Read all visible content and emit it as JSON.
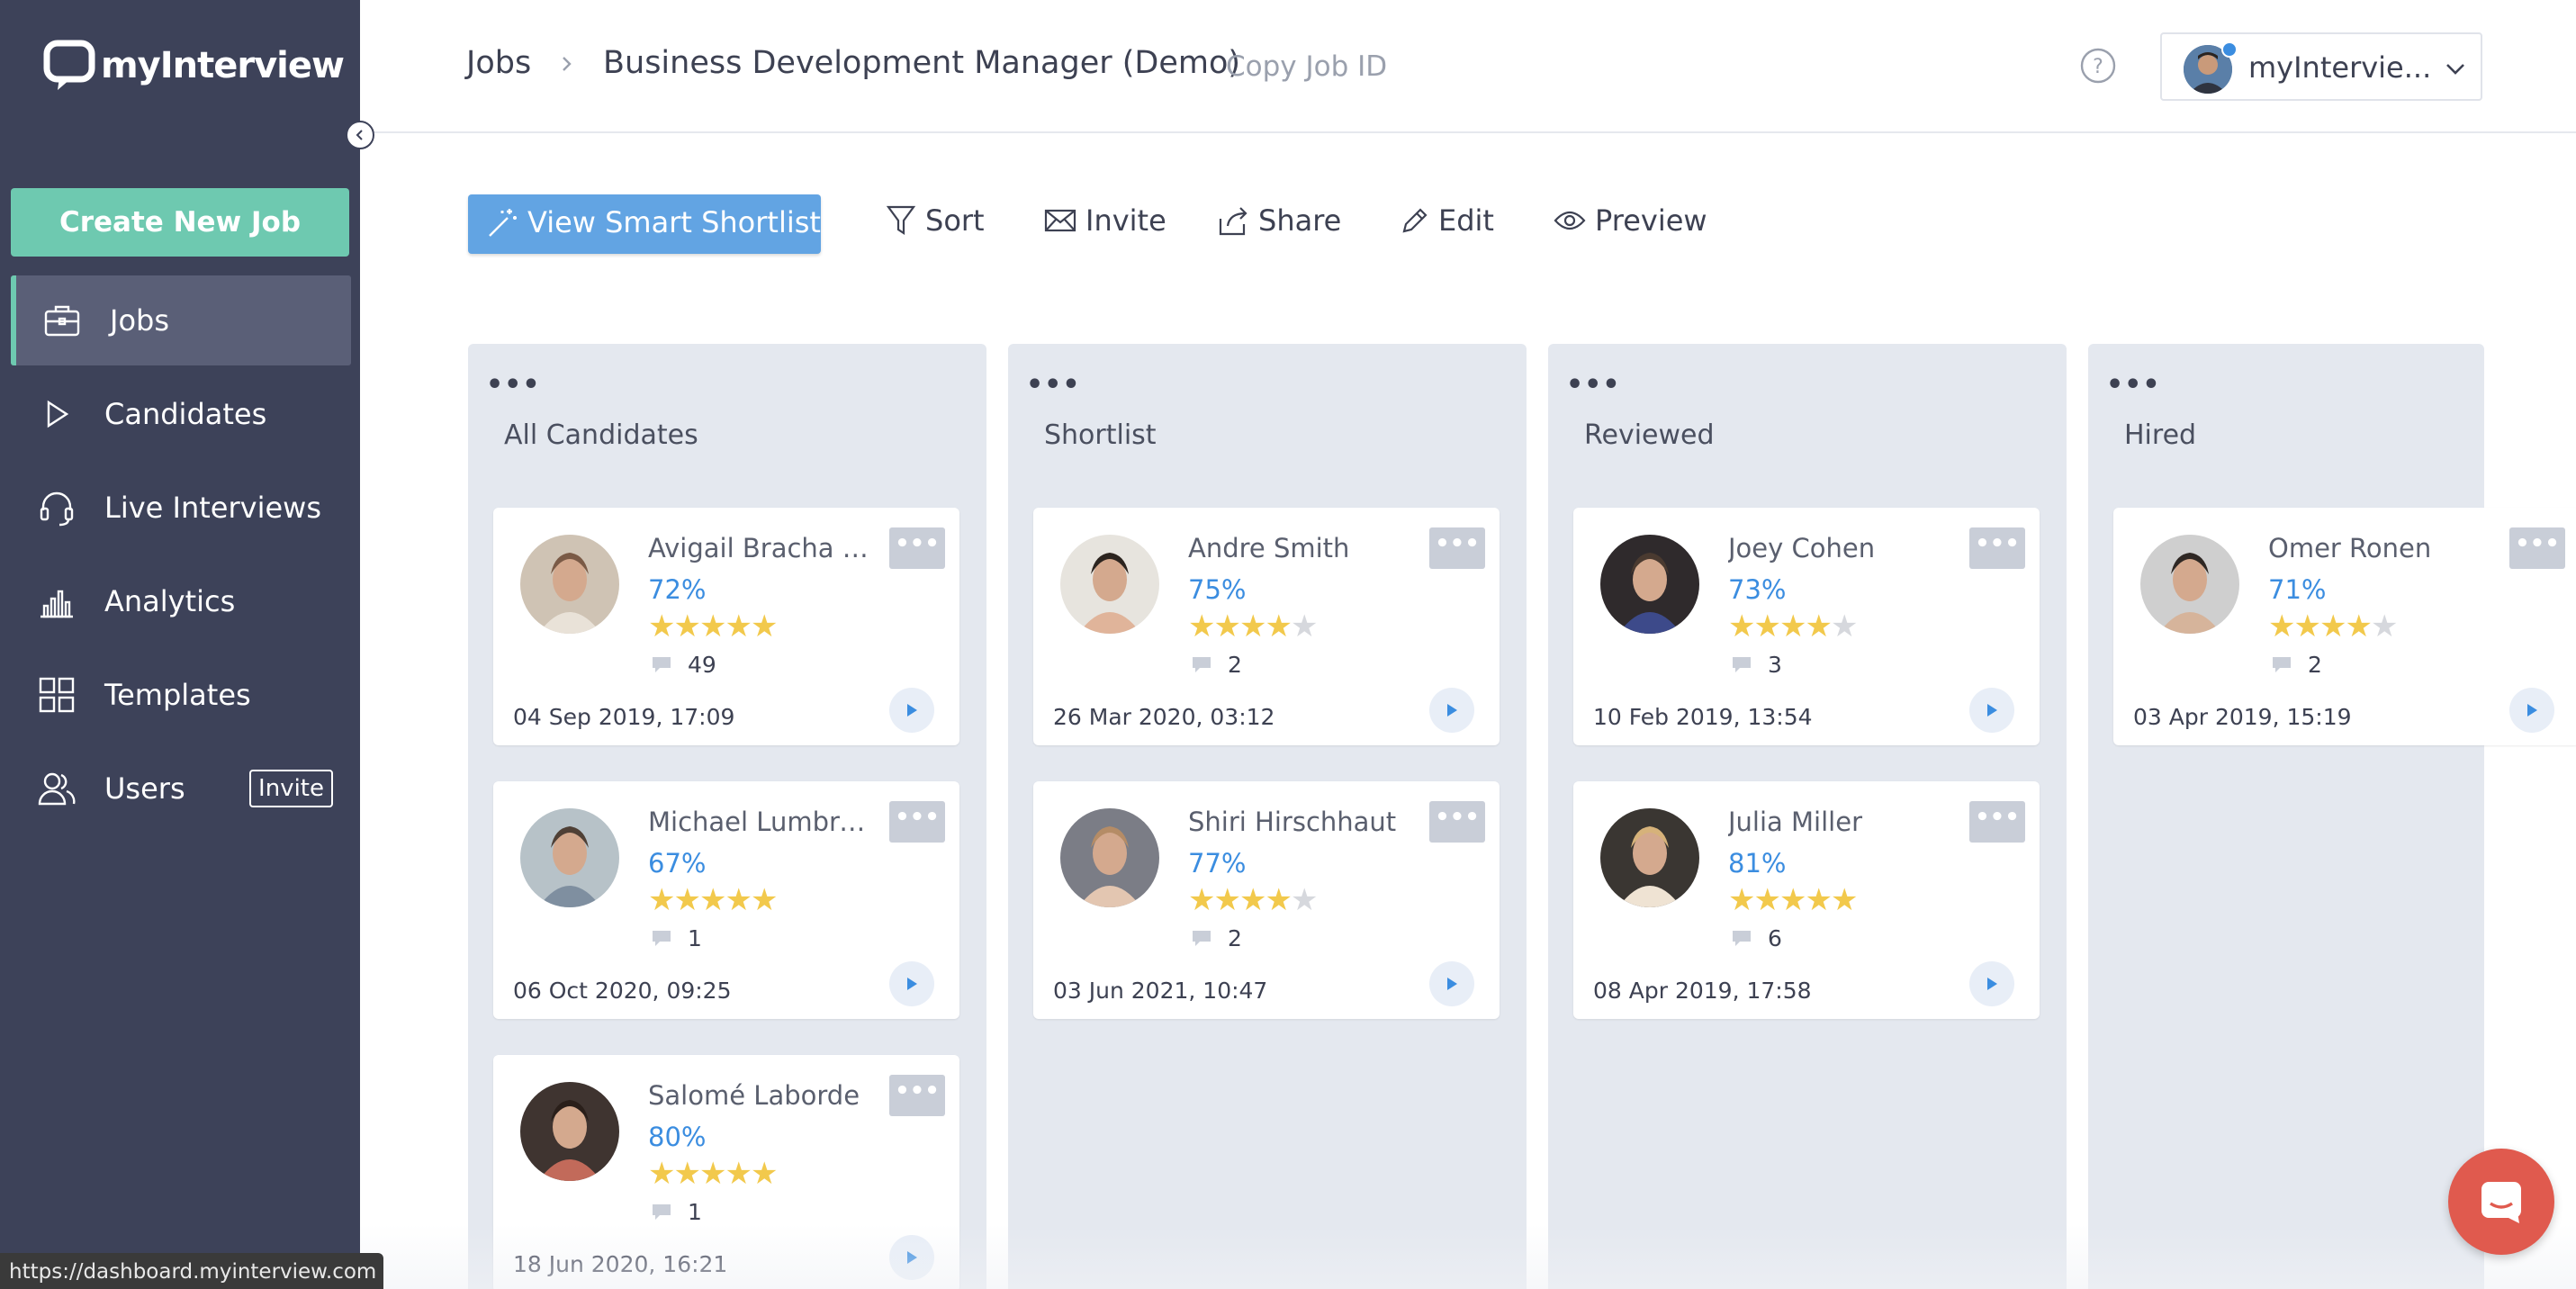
{
  "app": {
    "logo_text": "myInterview",
    "status_url": "https://dashboard.myinterview.com"
  },
  "sidebar": {
    "create_label": "Create New Job",
    "items": [
      {
        "label": "Jobs",
        "icon": "briefcase-icon"
      },
      {
        "label": "Candidates",
        "icon": "play-outline-icon"
      },
      {
        "label": "Live Interviews",
        "icon": "headset-icon"
      },
      {
        "label": "Analytics",
        "icon": "bar-chart-icon"
      },
      {
        "label": "Templates",
        "icon": "grid-icon"
      },
      {
        "label": "Users",
        "icon": "users-icon",
        "badge": "Invite"
      }
    ]
  },
  "header": {
    "breadcrumb_root": "Jobs",
    "job_title": "Business Development Manager (Demo)",
    "copy_job_id": "Copy Job ID",
    "account_name": "myIntervie..."
  },
  "toolbar": {
    "smart_shortlist": "View Smart Shortlist",
    "sort": "Sort",
    "invite": "Invite",
    "share": "Share",
    "edit": "Edit",
    "preview": "Preview"
  },
  "columns": [
    {
      "title": "All Candidates",
      "cards": [
        {
          "name": "Avigail Bracha So...",
          "score": "72%",
          "stars": 5,
          "comments": "49",
          "date": "04 Sep 2019, 17:09"
        },
        {
          "name": "Michael Lumbroso",
          "score": "67%",
          "stars": 5,
          "comments": "1",
          "date": "06 Oct 2020, 09:25"
        },
        {
          "name": "Salomé Laborde",
          "score": "80%",
          "stars": 5,
          "comments": "1",
          "date": "18 Jun 2020, 16:21"
        }
      ]
    },
    {
      "title": "Shortlist",
      "cards": [
        {
          "name": "Andre Smith",
          "score": "75%",
          "stars": 4,
          "comments": "2",
          "date": "26 Mar 2020, 03:12"
        },
        {
          "name": "Shiri Hirschhaut",
          "score": "77%",
          "stars": 4,
          "comments": "2",
          "date": "03 Jun 2021, 10:47"
        }
      ]
    },
    {
      "title": "Reviewed",
      "cards": [
        {
          "name": "Joey Cohen",
          "score": "73%",
          "stars": 4,
          "comments": "3",
          "date": "10 Feb 2019, 13:54"
        },
        {
          "name": "Julia Miller",
          "score": "81%",
          "stars": 5,
          "comments": "6",
          "date": "08 Apr 2019, 17:58"
        }
      ]
    },
    {
      "title": "Hired",
      "cards": [
        {
          "name": "Omer Ronen",
          "score": "71%",
          "stars": 4,
          "comments": "2",
          "date": "03 Apr 2019, 15:19"
        }
      ]
    }
  ],
  "colors": {
    "sidebar_bg": "#3d4259",
    "accent_green": "#6ec9b0",
    "accent_blue": "#62a4e3",
    "score_blue": "#3b8de0",
    "star_gold": "#f2c94c",
    "column_bg": "#e4e8ef",
    "chat_red": "#e05a4e"
  }
}
